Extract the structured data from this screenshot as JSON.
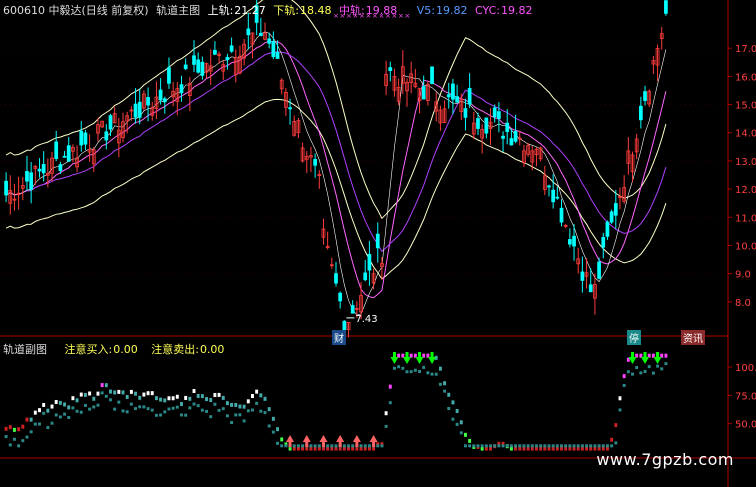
{
  "header": {
    "code_name": "600610 中毅达(日线 前复权)",
    "indicator": "轨道主图",
    "upper_label": "上轨:",
    "upper_value": "21.27",
    "lower_label": "下轨:",
    "lower_value": "18.48",
    "mid_label": "中轨:",
    "mid_value": "19.88",
    "v5_label": "V5:",
    "v5_value": "19.82",
    "cyc_label": "CYC:",
    "cyc_value": "19.82"
  },
  "sub_header": {
    "indicator": "轨道副图",
    "buy_label": "注意买入:",
    "buy_value": "0.00",
    "sell_label": "注意卖出:",
    "sell_value": "0.00"
  },
  "markers": {
    "low_price": "7.43",
    "tag_a": "财",
    "tag_b": "停",
    "tag_c": "资讯"
  },
  "watermark": "www.7gpzb.com",
  "colors": {
    "background": "#000000",
    "up": "#ff3c3c",
    "down": "#00ffff",
    "upper_band": "#ffffc8",
    "mid_band": "#ff66ff",
    "purple_line": "#b040ff",
    "buy_arrow": "#00ff00",
    "sell_arrow": "#ff6464",
    "axis": "#b00000"
  },
  "chart_data": [
    {
      "type": "candlestick",
      "title": "轨道主图",
      "ylim": [
        7,
        18
      ],
      "y_ticks": [
        "8.0",
        "9.0",
        "10.0",
        "11.0",
        "12.0",
        "13.0",
        "14.0",
        "15.0",
        "16.0",
        "17.0"
      ],
      "segments": [
        {
          "from_price": 11.8,
          "to_price": 17.6,
          "bars": 62
        },
        {
          "from_price": 17.6,
          "to_price": 12.1,
          "bars": 14
        },
        {
          "from_price": 10.2,
          "to_price": 7.43,
          "bars": 6
        },
        {
          "from_price": 7.43,
          "to_price": 9.8,
          "bars": 9
        },
        {
          "from_price": 16.2,
          "to_price": 13.6,
          "bars": 36
        },
        {
          "from_price": 13.6,
          "to_price": 8.4,
          "bars": 14
        },
        {
          "from_price": 8.4,
          "to_price": 18.2,
          "bars": 18
        }
      ]
    },
    {
      "type": "line",
      "title": "轨道副图",
      "ylim": [
        25,
        115
      ],
      "y_ticks": [
        "50.0",
        "75.0",
        "100.0"
      ],
      "buy_signals": 13,
      "sell_signals": 6
    }
  ]
}
